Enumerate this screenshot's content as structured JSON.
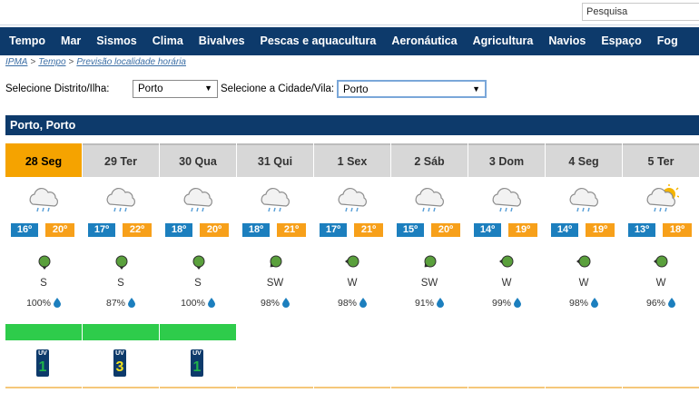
{
  "search": {
    "placeholder": "Pesquisa"
  },
  "nav": {
    "items": [
      "Tempo",
      "Mar",
      "Sismos",
      "Clima",
      "Bivalves",
      "Pescas e aquacultura",
      "Aeronáutica",
      "Agricultura",
      "Navios",
      "Espaço",
      "Fog"
    ]
  },
  "breadcrumb": {
    "items": [
      "IPMA",
      "Tempo",
      "Previsão localidade horária"
    ],
    "separator": ">"
  },
  "filters": {
    "district_label": "Selecione Distrito/Ilha:",
    "district_value": "Porto",
    "city_label": "Selecione a Cidade/Vila:",
    "city_value": "Porto"
  },
  "location": {
    "title": "Porto, Porto"
  },
  "days": [
    {
      "label": "28 Seg",
      "min": "16º",
      "max": "20º",
      "wind": "S",
      "humidity": "100%",
      "uv": "1",
      "uv_color": "#1fb34a",
      "icon": "rain-cloud-icon",
      "active": true
    },
    {
      "label": "29 Ter",
      "min": "17º",
      "max": "22º",
      "wind": "S",
      "humidity": "87%",
      "uv": "3",
      "uv_color": "#f1e21b",
      "icon": "rain-cloud-icon"
    },
    {
      "label": "30 Qua",
      "min": "18º",
      "max": "20º",
      "wind": "S",
      "humidity": "100%",
      "uv": "1",
      "uv_color": "#1fb34a",
      "icon": "rain-cloud-icon"
    },
    {
      "label": "31 Qui",
      "min": "18º",
      "max": "21º",
      "wind": "SW",
      "humidity": "98%",
      "icon": "rain-cloud-icon"
    },
    {
      "label": "1 Sex",
      "min": "17º",
      "max": "21º",
      "wind": "W",
      "humidity": "98%",
      "icon": "rain-cloud-icon"
    },
    {
      "label": "2 Sáb",
      "min": "15º",
      "max": "20º",
      "wind": "SW",
      "humidity": "91%",
      "icon": "rain-cloud-icon"
    },
    {
      "label": "3 Dom",
      "min": "14º",
      "max": "19º",
      "wind": "W",
      "humidity": "99%",
      "icon": "rain-cloud-icon"
    },
    {
      "label": "4 Seg",
      "min": "14º",
      "max": "19º",
      "wind": "W",
      "humidity": "98%",
      "icon": "rain-cloud-icon"
    },
    {
      "label": "5 Ter",
      "min": "13º",
      "max": "18º",
      "wind": "W",
      "humidity": "96%",
      "icon": "sun-rain-cloud-icon"
    }
  ],
  "uv_label": "UV"
}
